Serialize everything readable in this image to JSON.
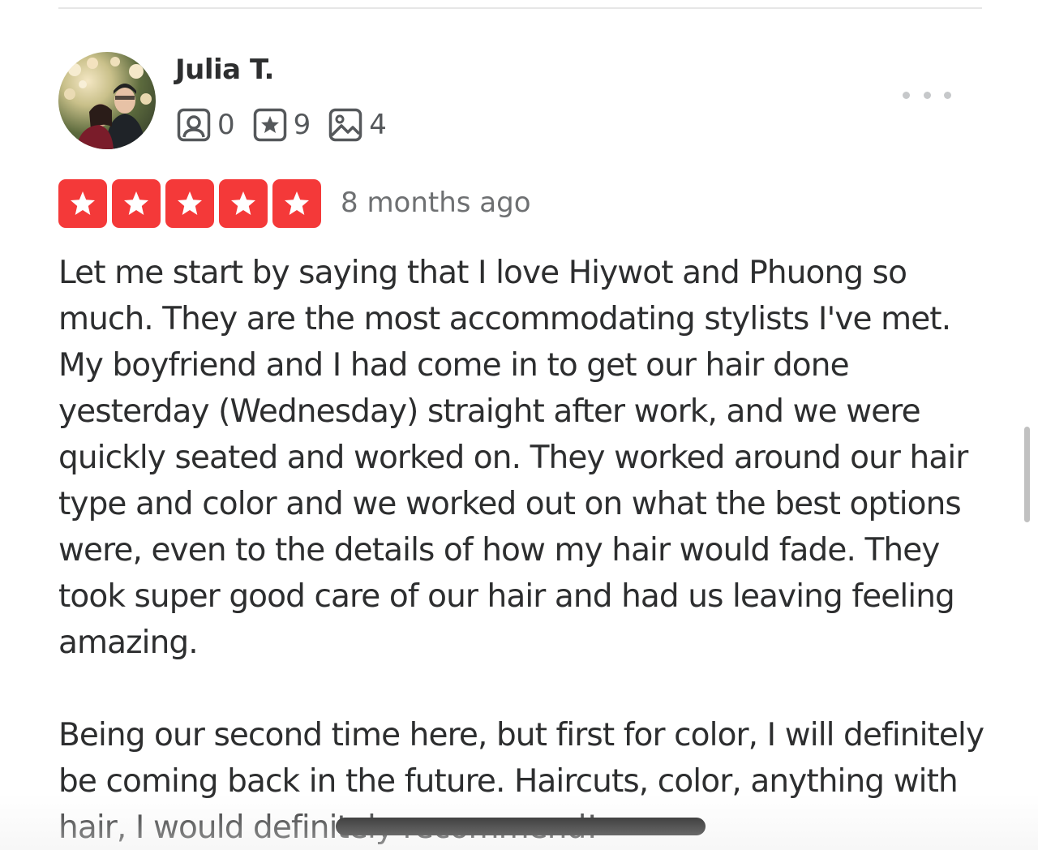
{
  "reviewer": {
    "name": "Julia T.",
    "stats": {
      "friends": "0",
      "reviews": "9",
      "photos": "4"
    }
  },
  "rating": {
    "stars": 5,
    "max": 5,
    "date": "8 months ago",
    "color": "#f43939"
  },
  "review": {
    "paragraphs": [
      "Let me start by saying that I love Hiywot and Phuong so much. They are the most accommodating stylists I've met. My boyfriend and I had come in to get our hair done yesterday (Wednesday) straight after work, and we were quickly seated and worked on. They worked around our hair type and color and we worked out on what the best options were, even to the details of how my hair would fade. They took super good care of our hair and had us leaving feeling amazing.",
      "Being our second time here, but first for color, I will definitely be coming back in the future.  Haircuts, color, anything with hair, I would definitely recommend!"
    ]
  },
  "icons": {
    "friends": "friends-icon",
    "reviews": "review-star-icon",
    "photos": "photo-icon",
    "more": "more-options-icon"
  }
}
